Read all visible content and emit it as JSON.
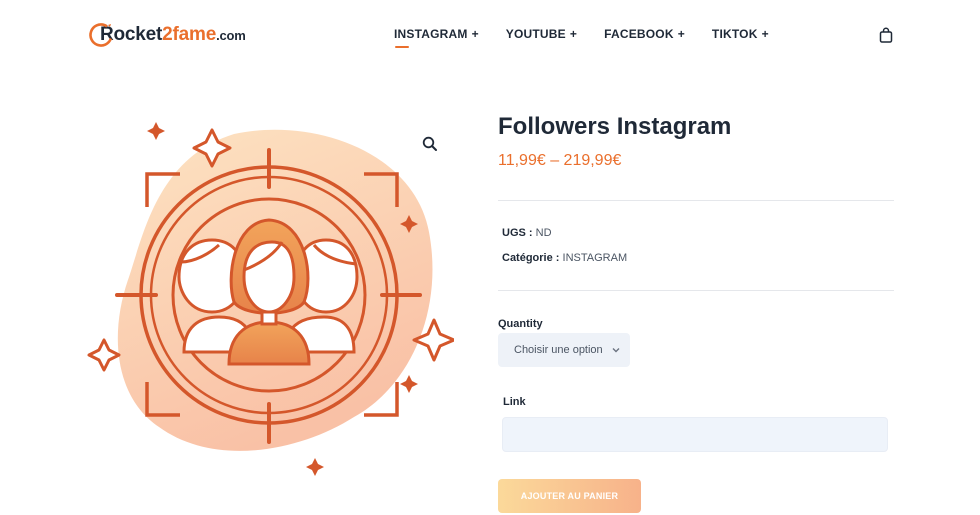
{
  "header": {
    "logo": {
      "name_part1": "Rocket",
      "name_part2": "2fame",
      "domain": ".com"
    },
    "nav": [
      {
        "label": "INSTAGRAM",
        "plus": "+",
        "active": true
      },
      {
        "label": "YOUTUBE",
        "plus": "+",
        "active": false
      },
      {
        "label": "FACEBOOK",
        "plus": "+",
        "active": false
      },
      {
        "label": "TIKTOK",
        "plus": "+",
        "active": false
      }
    ],
    "cart_icon": "shopping-bag-icon"
  },
  "product": {
    "title": "Followers Instagram",
    "price": "11,99€ – 219,99€",
    "zoom_icon": "magnifier-icon",
    "meta": {
      "sku_label": "UGS :",
      "sku_value": "ND",
      "category_label": "Catégorie :",
      "category_value": "INSTAGRAM"
    },
    "quantity": {
      "label": "Quantity",
      "selected": "Choisir une option"
    },
    "link": {
      "label": "Link",
      "value": "",
      "placeholder": ""
    },
    "add_to_cart_label": "AJOUTER AU PANIER"
  },
  "colors": {
    "accent": "#ea6f2c",
    "text": "#1f2937",
    "input_bg": "#eef2f8",
    "button_gradient_start": "#fbd99a",
    "button_gradient_end": "#f7b28a"
  }
}
